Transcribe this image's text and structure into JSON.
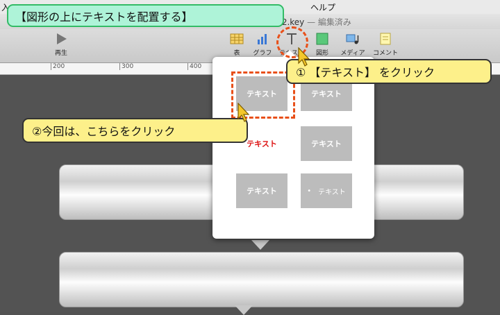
{
  "menubar": {
    "items": [
      "入",
      "ヘルプ"
    ]
  },
  "window": {
    "title": "定 2.key",
    "title_suffix": " — 編集済み"
  },
  "toolbar": {
    "play_label": "再生",
    "table_label": "表",
    "chart_label": "グラフ",
    "text_label": "テキスト",
    "shape_label": "図形",
    "media_label": "メディア",
    "comment_label": "コメント"
  },
  "ruler": {
    "ticks": [
      "200",
      "300",
      "400"
    ]
  },
  "popup": {
    "styles": [
      "テキスト",
      "テキスト",
      "テキスト",
      "テキスト",
      "テキスト",
      "テキスト",
      "テキスト"
    ],
    "bullet": "•"
  },
  "annotations": {
    "title": "【図形の上にテキストを配置する】",
    "step1": "① 【テキスト】 をクリック",
    "step2": "②今回は、こちらをクリック"
  },
  "colors": {
    "callout": "#fdf08a",
    "title_box": "#aef3d8",
    "dash": "#e8501a",
    "red_text": "#dd1111"
  }
}
